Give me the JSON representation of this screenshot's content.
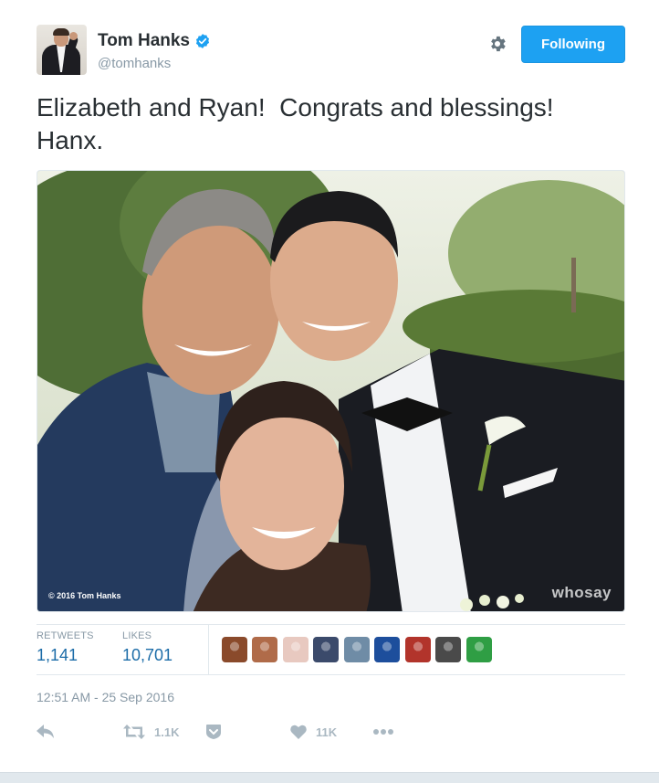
{
  "author": {
    "name": "Tom Hanks",
    "handle": "@tomhanks",
    "verified_icon": "verified-badge-icon"
  },
  "header": {
    "settings_icon": "gear-icon",
    "follow_label": "Following"
  },
  "tweet": {
    "text": "Elizabeth and Ryan!  Congrats and blessings!\nHanx."
  },
  "photo": {
    "credit": "© 2016 Tom Hanks",
    "watermark": "whosay"
  },
  "stats": {
    "retweets_label": "RETWEETS",
    "retweets_value": "1,141",
    "likes_label": "LIKES",
    "likes_value": "10,701"
  },
  "likers": [
    {
      "name": "liker-avatar-1",
      "color": "#8a4a2b"
    },
    {
      "name": "liker-avatar-2",
      "color": "#b06b49"
    },
    {
      "name": "liker-avatar-3",
      "color": "#e8c9c0"
    },
    {
      "name": "liker-avatar-4",
      "color": "#3b4a6b"
    },
    {
      "name": "liker-avatar-5",
      "color": "#6f8ca6"
    },
    {
      "name": "liker-avatar-6",
      "color": "#1d4e9c"
    },
    {
      "name": "liker-avatar-7",
      "color": "#b2342b"
    },
    {
      "name": "liker-avatar-8",
      "color": "#4a4a4a"
    },
    {
      "name": "liker-avatar-9",
      "color": "#2f9e44"
    }
  ],
  "timestamp": "12:51 AM - 25 Sep 2016",
  "actions": {
    "reply_icon": "reply-icon",
    "retweet_icon": "retweet-icon",
    "retweet_count": "1.1K",
    "moment_icon": "bookmark-icon",
    "like_icon": "heart-icon",
    "like_count": "11K",
    "more_icon": "more-icon"
  },
  "colors": {
    "accent": "#1da1f2",
    "stat_value": "#1b6ca8",
    "muted": "#8899a6",
    "action_gray": "#aab8c2"
  }
}
